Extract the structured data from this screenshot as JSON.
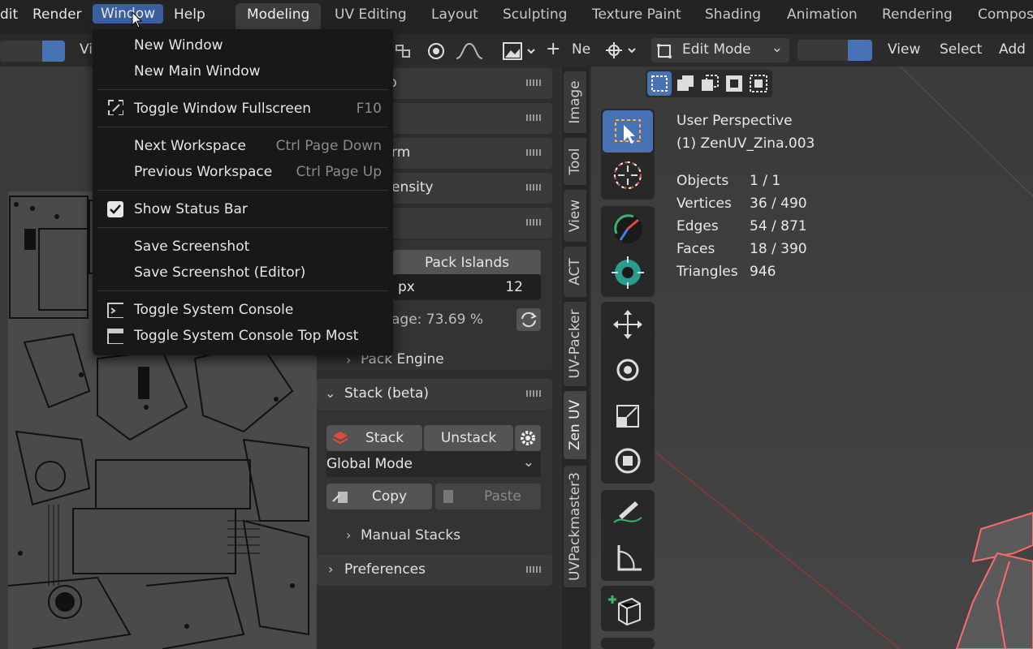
{
  "topbar": {
    "menus": [
      "dit",
      "Render",
      "Window",
      "Help"
    ],
    "workspace_tabs": [
      "Modeling",
      "UV Editing",
      "Layout",
      "Sculpting",
      "Texture Paint",
      "Shading",
      "Animation",
      "Rendering",
      "Compos"
    ]
  },
  "left_header": {
    "view_label": "Vi",
    "new_label": "Ne"
  },
  "window_menu": {
    "new_window": "New Window",
    "new_main_window": "New Main Window",
    "toggle_fullscreen": "Toggle Window Fullscreen",
    "toggle_fullscreen_shortcut": "F10",
    "next_workspace": "Next Workspace",
    "next_workspace_shortcut": "Ctrl Page Down",
    "previous_workspace": "Previous Workspace",
    "previous_workspace_shortcut": "Ctrl Page Up",
    "show_status_bar": "Show Status Bar",
    "save_screenshot": "Save Screenshot",
    "save_screenshot_editor": "Save Screenshot (Editor)",
    "toggle_console": "Toggle System Console",
    "toggle_console_topmost": "Toggle System Console Top Most"
  },
  "npanel": {
    "p1_tail": "p",
    "p3_tail": "rm",
    "p4_tail": "ensity",
    "pack_islands": "Pack Islands",
    "margin_unit": "px",
    "margin_value": "12",
    "coverage": "age: 73.69 %",
    "pack_engine": "Pack Engine",
    "stack_title": "Stack (beta)",
    "stack_btn": "Stack",
    "unstack_btn": "Unstack",
    "global_mode": "Global Mode",
    "copy_btn": "Copy",
    "paste_btn": "Paste",
    "manual_stacks": "Manual Stacks",
    "preferences": "Preferences"
  },
  "vtabs": [
    "Image",
    "Tool",
    "View",
    "ACT",
    "UV-Packer",
    "Zen UV",
    "UVPackmaster3"
  ],
  "viewport": {
    "mode": "Edit Mode",
    "menu": [
      "View",
      "Select",
      "Add"
    ],
    "perspective": "User Perspective",
    "object_name": "(1) ZenUV_Zina.003",
    "stats": [
      {
        "label": "Objects",
        "value": "1 / 1"
      },
      {
        "label": "Vertices",
        "value": "36 / 490"
      },
      {
        "label": "Edges",
        "value": "54 / 871"
      },
      {
        "label": "Faces",
        "value": "18 / 390"
      },
      {
        "label": "Triangles",
        "value": "946"
      }
    ]
  },
  "colors": {
    "accent": "#4772b3",
    "menu_bg": "#181818",
    "active_menu": "#3a5f9f"
  }
}
